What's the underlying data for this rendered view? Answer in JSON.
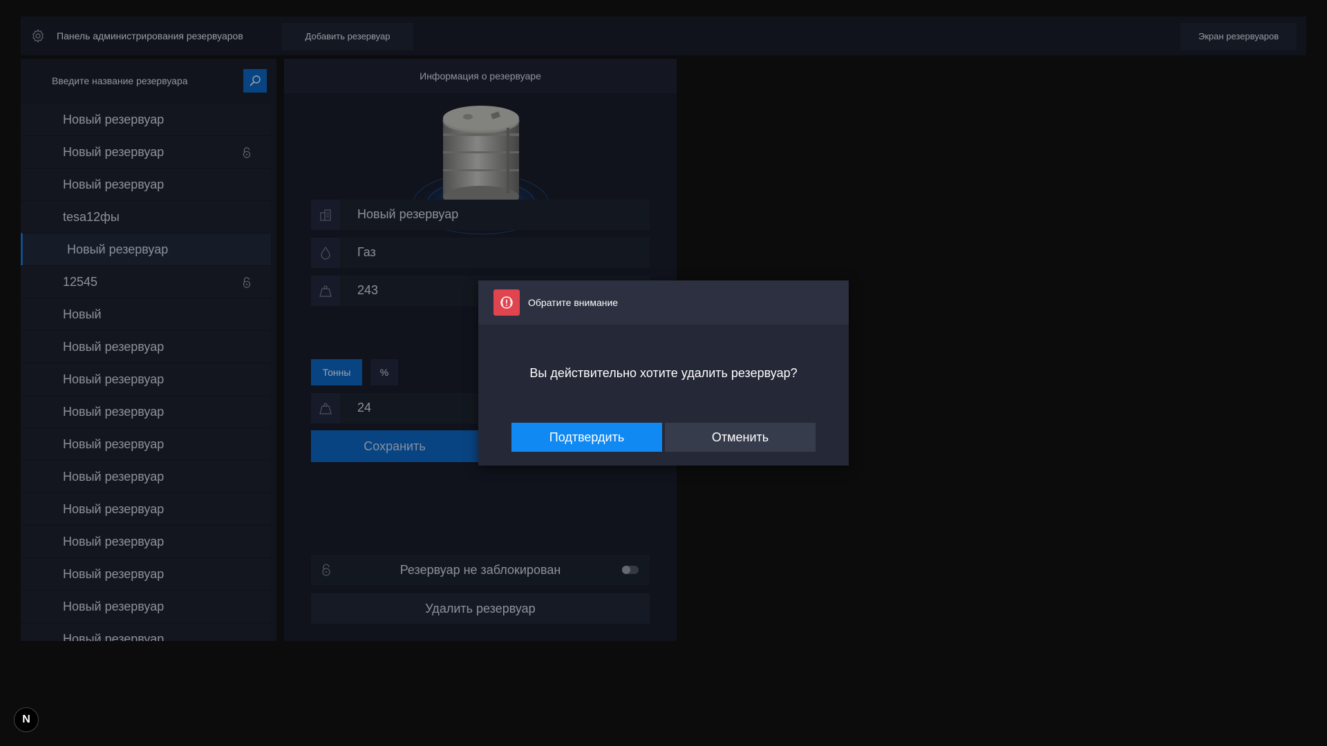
{
  "topbar": {
    "title": "Панель администрирования резервуаров",
    "add_button": "Добавить резервуар",
    "screen_button": "Экран резервуаров"
  },
  "sidebar": {
    "search_placeholder": "Введите название резервуара",
    "items": [
      {
        "label": "Новый резервуар",
        "locked": false
      },
      {
        "label": "Новый резервуар",
        "locked": true
      },
      {
        "label": "Новый резервуар",
        "locked": false
      },
      {
        "label": "tesa12фы",
        "locked": false
      },
      {
        "label": "Новый резервуар",
        "locked": false,
        "active": true
      },
      {
        "label": "12545",
        "locked": true
      },
      {
        "label": "Новый",
        "locked": false
      },
      {
        "label": "Новый резервуар",
        "locked": false
      },
      {
        "label": "Новый резервуар",
        "locked": false
      },
      {
        "label": "Новый резервуар",
        "locked": false
      },
      {
        "label": "Новый резервуар",
        "locked": false
      },
      {
        "label": "Новый резервуар",
        "locked": false
      },
      {
        "label": "Новый резервуар",
        "locked": false
      },
      {
        "label": "Новый резервуар",
        "locked": false
      },
      {
        "label": "Новый резервуар",
        "locked": false
      },
      {
        "label": "Новый резервуар",
        "locked": false
      },
      {
        "label": "Новый резервуар",
        "locked": false
      }
    ]
  },
  "main": {
    "header": "Информация о резервуаре",
    "name_value": "Новый резервуар",
    "product_value": "Газ",
    "capacity_value": "243",
    "unit_tons": "Тонны",
    "unit_percent": "%",
    "level_value": "24",
    "save_button": "Сохранить",
    "lock_status": "Резервуар не заблокирован",
    "lock_toggle_on": false,
    "delete_button": "Удалить резервуар"
  },
  "modal": {
    "title": "Обратите внимание",
    "message": "Вы действительно хотите удалить резервуар?",
    "confirm_button": "Подтвердить",
    "cancel_button": "Отменить"
  },
  "badge": {
    "label": "N"
  },
  "colors": {
    "accent": "#1089f2",
    "danger": "#e0444f",
    "panel": "#171b27"
  }
}
